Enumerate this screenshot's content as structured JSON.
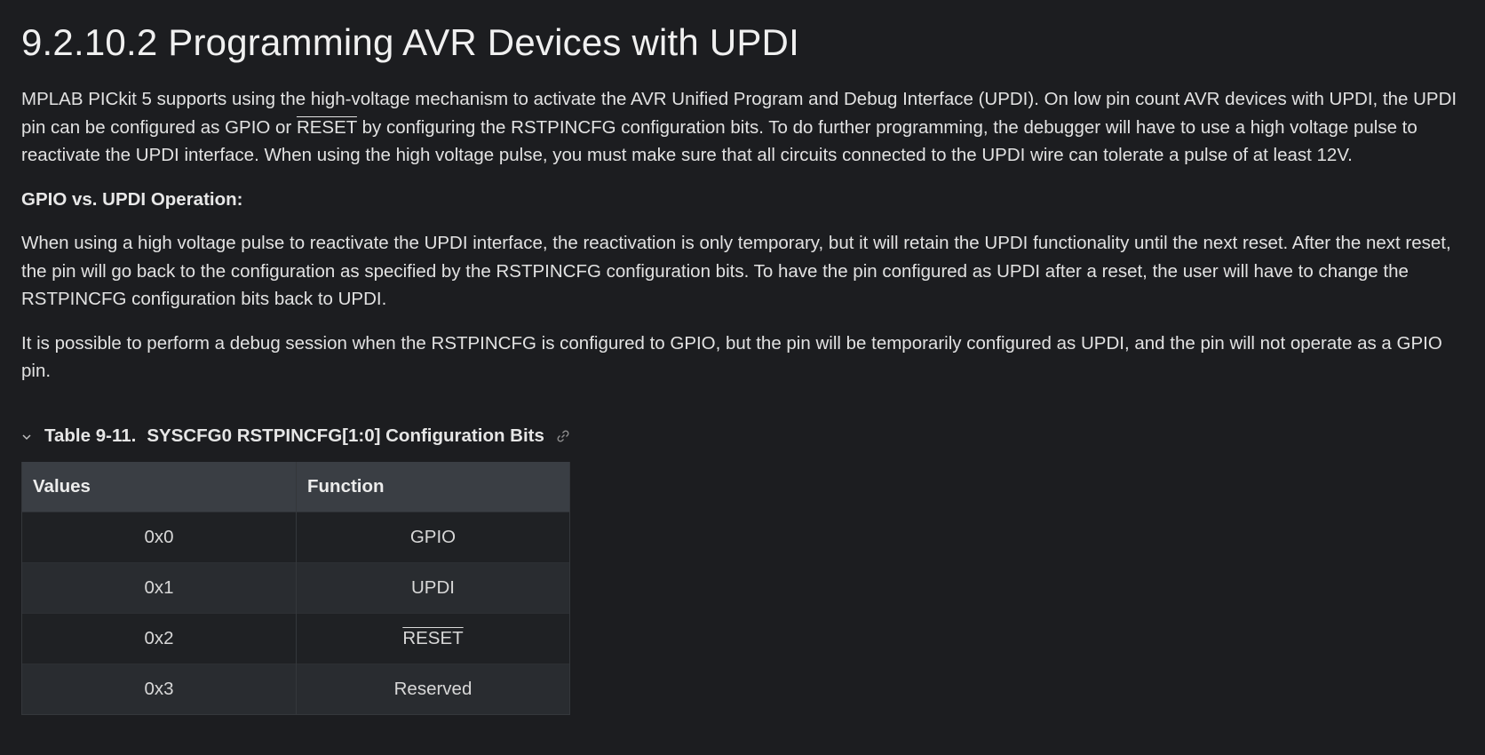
{
  "heading": "9.2.10.2 Programming AVR Devices with UPDI",
  "intro": {
    "part1": "MPLAB PICkit 5 supports using the high-voltage mechanism to activate the AVR Unified Program and Debug Interface (UPDI). On low pin count AVR devices with UPDI, the UPDI pin can be configured as GPIO or ",
    "reset": "RESET",
    "part2": " by configuring the RSTPINCFG configuration bits. To do further programming, the debugger will have to use a high voltage pulse to reactivate the UPDI interface. When using the high voltage pulse, you must make sure that all circuits connected to the UPDI wire can tolerate a pulse of at least 12V."
  },
  "subheading": "GPIO vs. UPDI Operation:",
  "paragraph2": "When using a high voltage pulse to reactivate the UPDI interface, the reactivation is only temporary, but it will retain the UPDI functionality until the next reset. After the next reset, the pin will go back to the configuration as specified by the RSTPINCFG configuration bits. To have the pin configured as UPDI after a reset, the user will have to change the RSTPINCFG configuration bits back to UPDI.",
  "paragraph3": "It is possible to perform a debug session when the RSTPINCFG is configured to GPIO, but the pin will be temporarily configured as UPDI, and the pin will not operate as a GPIO pin.",
  "table": {
    "toggle_icon": "chevron-down-icon",
    "label": "Table 9-11.",
    "title": "SYSCFG0 RSTPINCFG[1:0] Configuration Bits",
    "link_icon": "link-icon",
    "headers": [
      "Values",
      "Function"
    ],
    "rows": [
      {
        "value": "0x0",
        "function": "GPIO"
      },
      {
        "value": "0x1",
        "function": "UPDI"
      },
      {
        "value": "0x2",
        "function": "RESET"
      },
      {
        "value": "0x3",
        "function": "Reserved"
      }
    ]
  }
}
